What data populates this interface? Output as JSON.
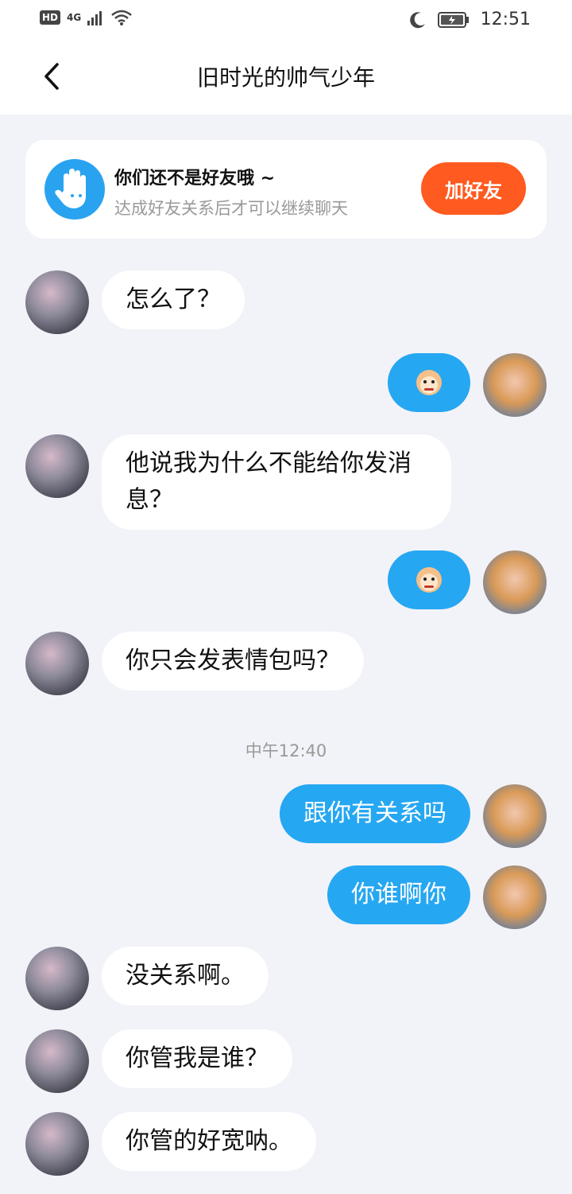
{
  "status_bar": {
    "badge": "HD",
    "network": "4G",
    "time": "12:51"
  },
  "header": {
    "title": "旧时光的帅气少年"
  },
  "notice": {
    "title": "你们还不是好友哦 ~",
    "subtitle": "达成好友关系后才可以继续聊天",
    "button": "加好友"
  },
  "messages": [
    {
      "from": "other",
      "text": "怎么了？"
    },
    {
      "from": "me",
      "type": "sticker",
      "icon": "monkey-sticker-icon"
    },
    {
      "from": "other",
      "text": "他说我为什么不能给你发消息？"
    },
    {
      "from": "me",
      "type": "sticker",
      "icon": "monkey-sticker-icon"
    },
    {
      "from": "other",
      "text": "你只会发表情包吗？"
    },
    {
      "timestamp": "中午12:40"
    },
    {
      "from": "me",
      "text": "跟你有关系吗"
    },
    {
      "from": "me",
      "text": "你谁啊你"
    },
    {
      "from": "other",
      "text": "没关系啊。"
    },
    {
      "from": "other",
      "text": "你管我是谁？"
    },
    {
      "from": "other",
      "text": "你管的好宽呐。"
    }
  ],
  "colors": {
    "accent": "#26a7f2",
    "add_button": "#ff5a1f",
    "background": "#f2f3f8"
  }
}
